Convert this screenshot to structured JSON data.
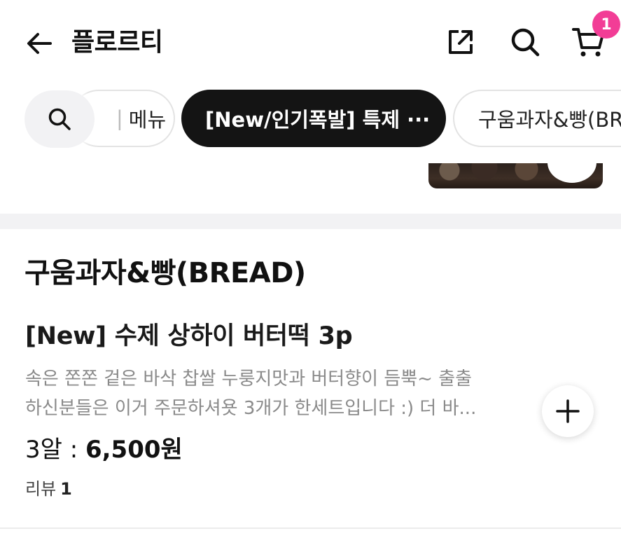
{
  "header": {
    "title": "플로르티",
    "back_icon": "arrow-left-icon",
    "share_icon": "share-external-icon",
    "search_icon": "search-icon",
    "cart_icon": "cart-icon",
    "cart_count": "1",
    "badge_color": "#f23d96"
  },
  "tabs": {
    "search_icon": "search-icon",
    "items": [
      {
        "label": "메뉴"
      },
      {
        "label": "[New/인기폭발] 특제 ···",
        "active": true
      },
      {
        "label": "구움과자&빵(BR"
      }
    ],
    "active_color": "#141414"
  },
  "section": {
    "title": "구움과자&빵(BREAD)"
  },
  "item": {
    "name": "[New] 수제 상하이 버터떡 3p",
    "desc_line1": "속은 쫀쫀 겉은 바삭 찹쌀 누룽지맛과 버터향이 듬뿍~ 출출",
    "desc_line2": "하신분들은 이거 주문하셔욧 3개가 한세트입니다 :) 더 바...",
    "price_label": "3알 : ",
    "price_value": "6,500원",
    "review_label": "리뷰",
    "review_count": "1",
    "add_icon": "plus-icon"
  }
}
